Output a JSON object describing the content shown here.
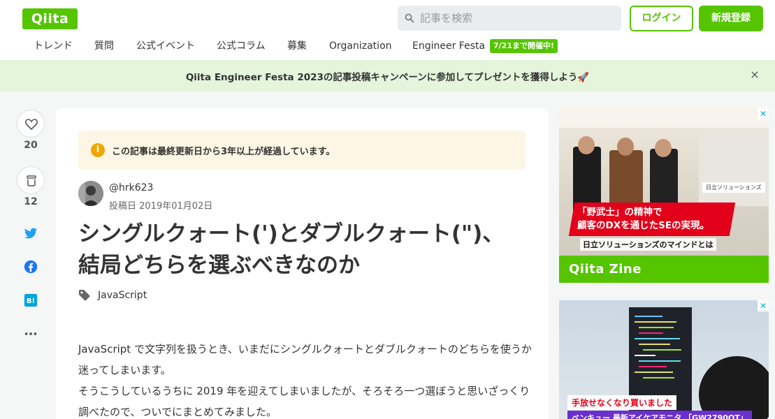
{
  "header": {
    "logo": "Qiita",
    "search_placeholder": "記事を検索",
    "login": "ログイン",
    "signup": "新規登録"
  },
  "nav": {
    "items": [
      "トレンド",
      "質問",
      "公式イベント",
      "公式コラム",
      "募集",
      "Organization",
      "Engineer Festa"
    ],
    "festa_badge": "7/21まで開催中!"
  },
  "banner": {
    "text": "Qiita Engineer Festa 2023の記事投稿キャンペーンに参加してプレゼントを獲得しよう🚀",
    "close": "×"
  },
  "actions": {
    "likes": "20",
    "stocks": "12"
  },
  "article": {
    "notice": "この記事は最終更新日から3年以上が経過しています。",
    "notice_icon": "i",
    "author": "@hrk623",
    "posted": "投稿日 2019年01月02日",
    "title_line1": "シングルクォート(')とダブルクォート(\")、",
    "title_line2": "結局どちらを選ぶべきなのか",
    "tag": "JavaScript",
    "paragraph1": "JavaScript で文字列を扱うとき、いまだにシングルクォートとダブルクォートのどちらを使うか迷ってしまいます。",
    "paragraph2": "そうこうしているうちに 2019 年を迎えてしまいましたが、そろそろ一つ選ぼうと思いざっくり調べたので、ついでにまとめてみました。"
  },
  "ads": {
    "ad1": {
      "headline1": "「野武士」の精神で",
      "headline2": "顧客のDXを通じたSEの実現。",
      "sub": "日立ソリューションズのマインドとは",
      "corp": "日立ソリューションズ",
      "brand": "Qiita Zine",
      "close": "✕"
    },
    "ad2": {
      "text1": "手放せなくなり買いました",
      "text2": "ベンキュー 最新アイケアモニタ 「GW2790QT」",
      "close": "✕"
    }
  },
  "colors": {
    "brand_green": "#55c500",
    "banner_bg": "#e4f5dc",
    "notice_bg": "#fdf6e4",
    "twitter": "#1da1f2",
    "facebook": "#1877f2",
    "hatena": "#00a4de"
  },
  "icons": [
    "search-icon",
    "heart-icon",
    "stock-icon",
    "twitter-icon",
    "facebook-icon",
    "hatena-bookmark-icon",
    "more-icon",
    "tag-icon",
    "info-icon",
    "close-icon"
  ]
}
